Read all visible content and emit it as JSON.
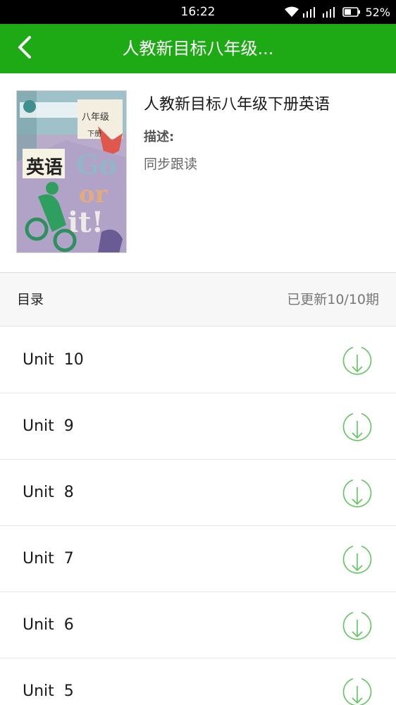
{
  "status_bar": {
    "time": "16:22",
    "battery": "52%",
    "icons": [
      "wifi-icon",
      "signal-icon",
      "signal-icon",
      "battery-icon"
    ]
  },
  "app_bar": {
    "back_icon": "chevron-left-icon",
    "title": "人教新目标八年级..."
  },
  "book": {
    "title": "人教新目标八年级下册英语",
    "description_label": "描述:",
    "description": "同步跟读",
    "cover": {
      "grade": "八年级",
      "volume": "下册",
      "subject": "英语"
    }
  },
  "catalog": {
    "label": "目录",
    "status": "已更新10/10期"
  },
  "units": [
    {
      "label": "Unit  10"
    },
    {
      "label": "Unit  9"
    },
    {
      "label": "Unit  8"
    },
    {
      "label": "Unit  7"
    },
    {
      "label": "Unit  6"
    },
    {
      "label": "Unit  5"
    }
  ],
  "colors": {
    "accent": "#1eaa14",
    "download_icon": "#5cc85a"
  }
}
